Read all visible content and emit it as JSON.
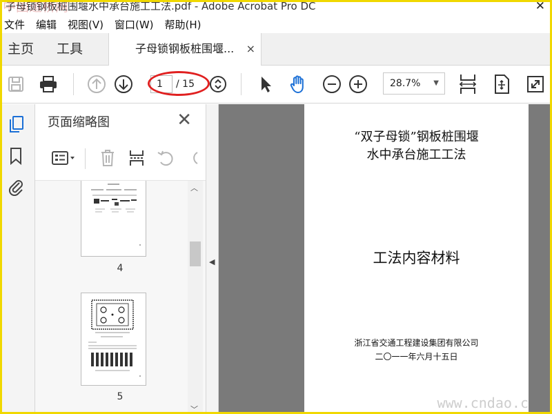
{
  "window": {
    "title": "子母锁钢板桩围堰水中承台施工工法.pdf - Adobe Acrobat Pro DC",
    "watermark_top": "中国道桥网"
  },
  "menu": [
    "文件",
    "编辑",
    "视图(V)",
    "窗口(W)",
    "帮助(H)"
  ],
  "tabs": {
    "home": "主页",
    "tools": "工具",
    "doc": "子母锁钢板桩围堰...",
    "close": "×"
  },
  "toolbar": {
    "current_page": "1",
    "total_pages": "/ 15",
    "zoom": "28.7%",
    "zoom_arrow": "▼"
  },
  "panel": {
    "title": "页面缩略图",
    "close": "✕",
    "thumbnails": [
      {
        "number": "4"
      },
      {
        "number": "5"
      }
    ]
  },
  "document": {
    "title_line1": "“双子母锁”钢板桩围堰",
    "title_line2": "水中承台施工工法",
    "subtitle": "工法内容材料",
    "organization": "浙江省交通工程建设集团有限公司",
    "date": "二〇一一年六月十五日"
  },
  "watermark_bottom": "www.cndao.c",
  "colors": {
    "border": "#f0d800",
    "annotation_circle": "#e02020",
    "hand_tool": "#1a6fd6",
    "doc_background": "#7a7a7a"
  }
}
